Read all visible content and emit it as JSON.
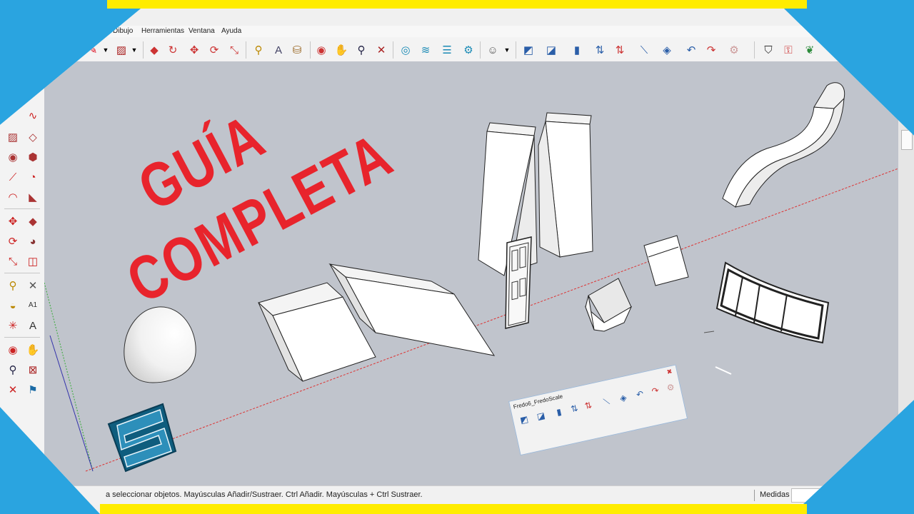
{
  "menu": {
    "items": [
      "Dibujo",
      "Herramientas",
      "Ventana",
      "Ayuda"
    ]
  },
  "headline": {
    "line1": "GUÍA",
    "line2": "COMPLETA"
  },
  "fredo_toolbar": {
    "title": "Fredo6_FredoScale",
    "close": "✖"
  },
  "status": {
    "hint": "a seleccionar objetos. Mayúsculas   Añadir/Sustraer. Ctrl   Añadir. Mayúsculas + Ctrl   Sustraer.",
    "measurements_label": "Medidas",
    "measurements_value": ""
  },
  "colors": {
    "accent": "#e8242c",
    "viewport": "#c0c4cc",
    "frame_blue": "#2aa4e0",
    "frame_yellow": "#ffec00"
  },
  "toolbar_icons": [
    "pencil-icon",
    "chevron-down-icon",
    "rectangle-icon",
    "chevron-down-icon",
    "push-pull-icon",
    "follow-me-icon",
    "move-icon",
    "rotate-icon",
    "scale-icon",
    "tape-measure-icon",
    "text-icon",
    "paint-bucket-icon",
    "orbit-icon",
    "pan-icon",
    "zoom-icon",
    "zoom-extents-icon",
    "warehouse-icon",
    "layers-icon",
    "share-icon",
    "extension-icon",
    "account-icon",
    "chevron-down-icon",
    "fredoscale-box-icon",
    "fredoscale-taper-icon",
    "fredoscale-twist-icon",
    "fredoscale-stretch-icon",
    "fredoscale-tilt-icon",
    "fredoscale-plane-icon",
    "fredoscale-bend-icon",
    "undo-icon",
    "redo-icon",
    "settings-icon",
    "shield-icon",
    "lock-icon",
    "leaf-icon"
  ],
  "left_tool_icons": [
    "line-icon",
    "freehand-icon",
    "rectangle-icon",
    "rotated-rectangle-icon",
    "circle-icon",
    "polygon-icon",
    "arc-icon",
    "pie-icon",
    "two-point-arc-icon",
    "three-point-arc-icon",
    "move-icon",
    "push-pull-icon",
    "rotate-icon",
    "follow-me-icon",
    "scale-icon",
    "offset-icon",
    "tape-measure-icon",
    "dimension-icon",
    "protractor-icon",
    "text-icon",
    "axes-icon",
    "3d-text-icon",
    "orbit-icon",
    "pan-icon",
    "zoom-icon",
    "zoom-window-icon",
    "zoom-extents-icon",
    "walk-icon",
    "look-around-icon",
    "position-camera-icon"
  ]
}
